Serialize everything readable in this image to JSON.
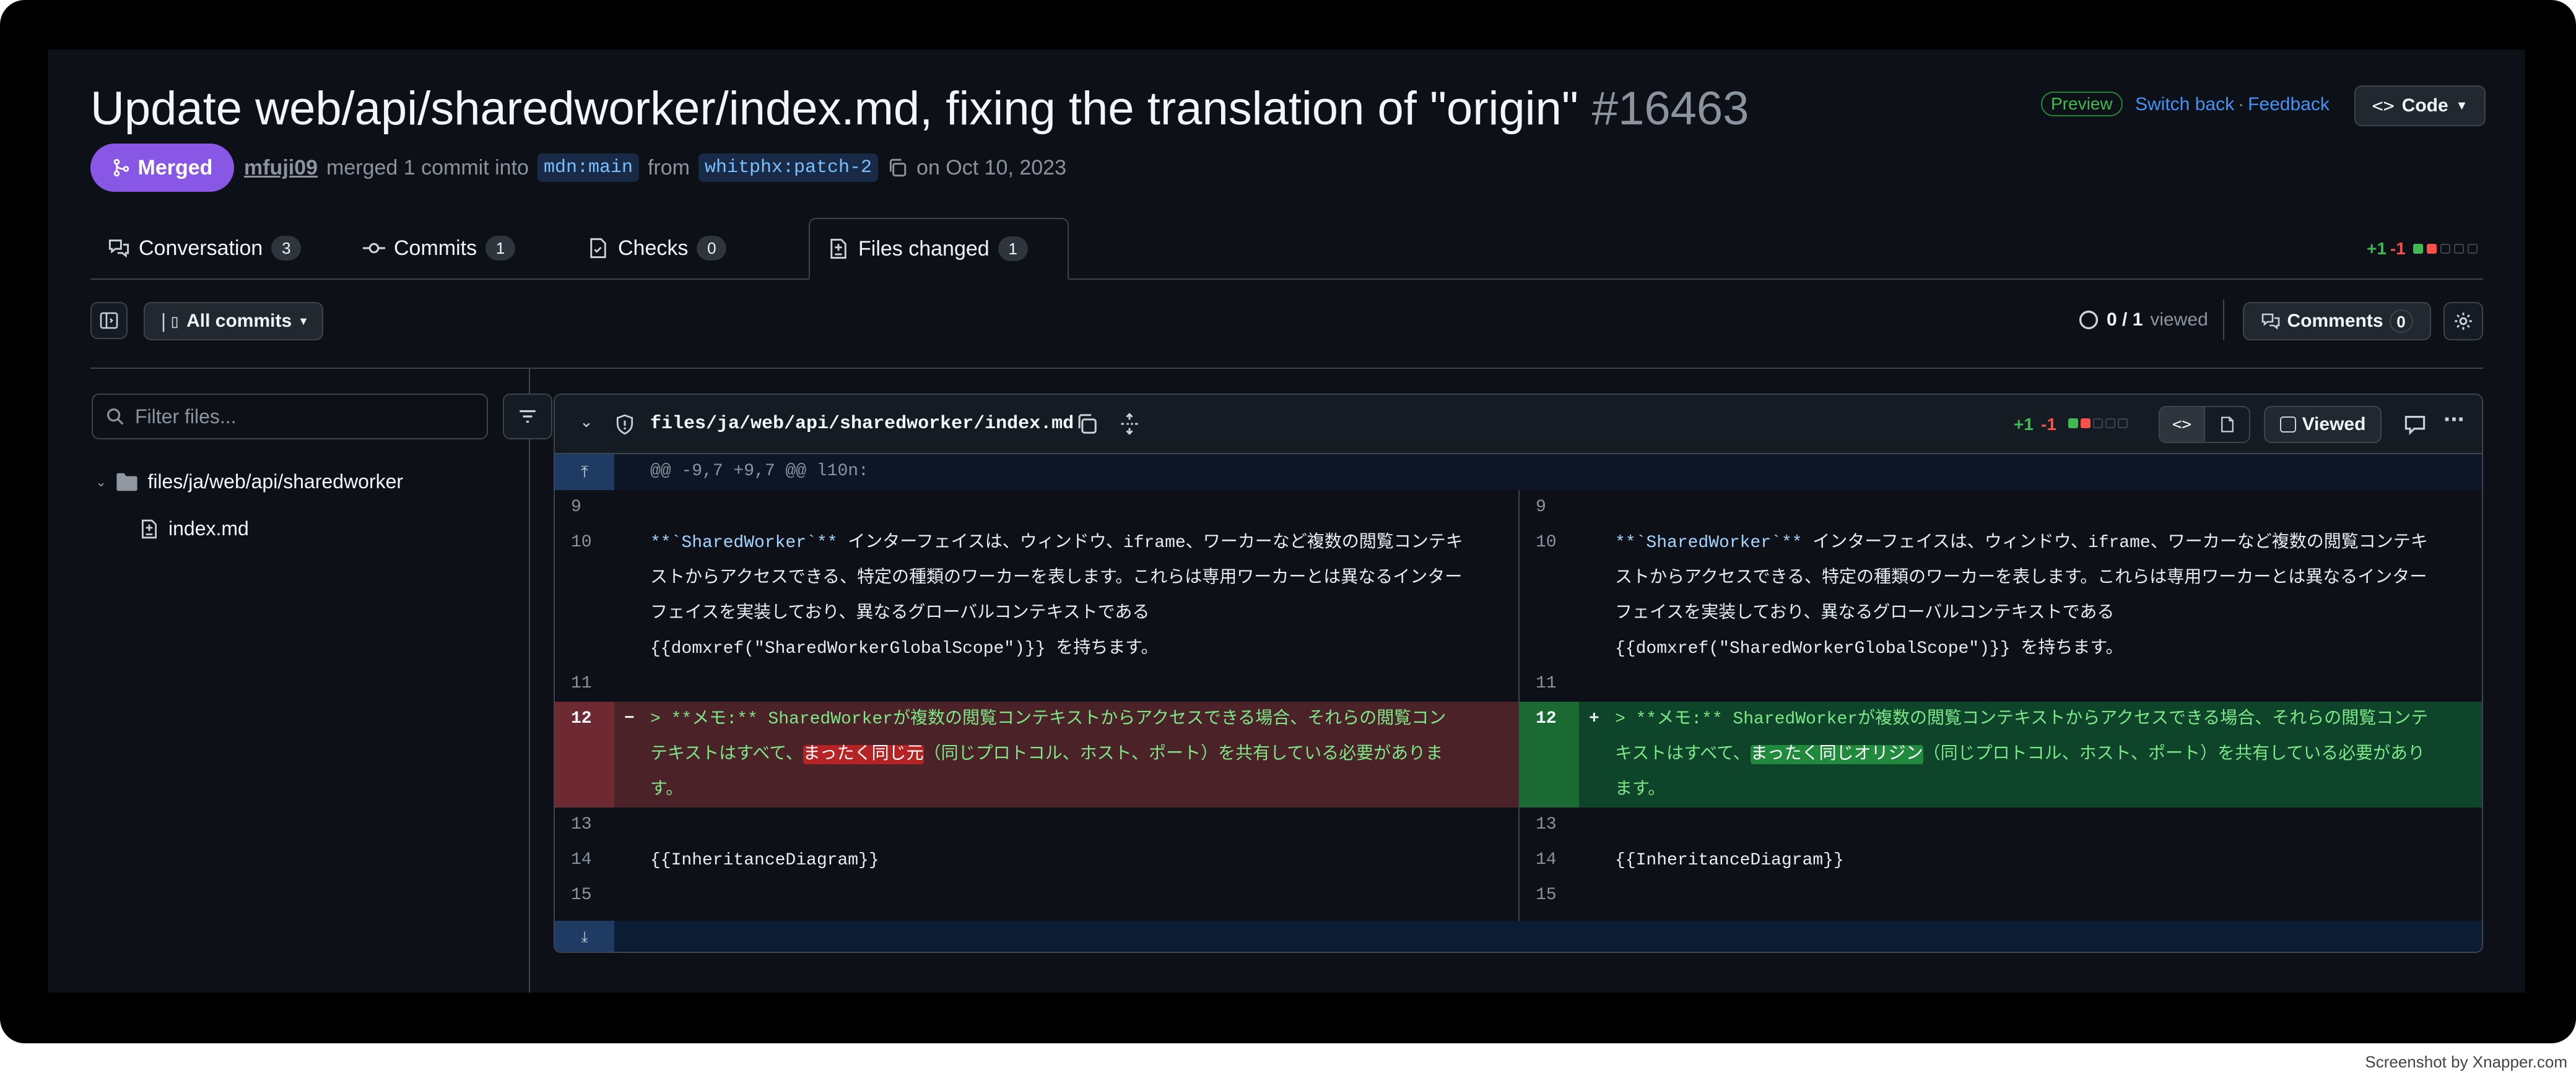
{
  "pr": {
    "title": "Update web/api/sharedworker/index.md, fixing the translation of \"origin\"",
    "number": "#16463",
    "state": "Merged",
    "author": "mfuji09",
    "merged_text": "merged 1 commit into",
    "base_branch": "mdn:main",
    "from_text": "from",
    "head_branch": "whitphx:patch-2",
    "date_text": "on Oct 10, 2023"
  },
  "header_right": {
    "preview_label": "Preview",
    "switch_back": "Switch back",
    "separator": "·",
    "feedback": "Feedback",
    "code_button": "Code"
  },
  "tabs": [
    {
      "label": "Conversation",
      "count": "3",
      "icon": "comment-discussion-icon"
    },
    {
      "label": "Commits",
      "count": "1",
      "icon": "git-commit-icon"
    },
    {
      "label": "Checks",
      "count": "0",
      "icon": "checklist-icon"
    },
    {
      "label": "Files changed",
      "count": "1",
      "icon": "file-diff-icon",
      "active": true
    }
  ],
  "diffstat": {
    "additions": "+1",
    "deletions": "-1"
  },
  "toolbar": {
    "all_commits": "All commits",
    "viewed_count": "0 / 1",
    "viewed_label": "viewed",
    "comments_label": "Comments",
    "comments_count": "0"
  },
  "sidebar": {
    "filter_placeholder": "Filter files...",
    "folder": "files/ja/web/api/sharedworker",
    "file": "index.md"
  },
  "file": {
    "path": "files/ja/web/api/sharedworker/index.md",
    "additions": "+1",
    "deletions": "-1",
    "viewed_button": "Viewed",
    "hunk_header": "@@ -9,7 +9,7 @@ l10n:"
  },
  "diff": {
    "lines": {
      "l9": "9",
      "l10": "10",
      "l11": "11",
      "l12": "12",
      "l13": "13",
      "l14": "14",
      "l15": "15"
    },
    "line10_bold": "**`SharedWorker`**",
    "line10_a": " インターフェイスは、ウィンドウ、iframe、ワーカーなど複数の閲覧コンテキ",
    "line10_b": "ストからアクセスできる、特定の種類のワーカーを表します。これらは専用ワーカーとは異なるインター",
    "line10_c": "フェイスを実装しており、異なるグローバルコンテキストである",
    "line10_d": "{{domxref(\"SharedWorkerGlobalScope\")}} を持ちます。",
    "line14": "{{InheritanceDiagram}}",
    "del_sign": "−",
    "add_sign": "+",
    "del_a": "> **メモ:** SharedWorkerが複数の閲覧コンテキストからアクセスできる場合、それらの閲覧コン",
    "del_b1": "テキストはすべて、",
    "del_word": "まったく同じ元",
    "del_b2": "（同じプロトコル、ホスト、ポート）を共有している必要がありま",
    "del_c": "す。",
    "add_a": "> **メモ:** SharedWorkerが複数の閲覧コンテキストからアクセスできる場合、それらの閲覧コンテ",
    "add_b1": "キストはすべて、",
    "add_word": "まったく同じオリジン",
    "add_b2": "（同じプロトコル、ホスト、ポート）を共有している必要があり",
    "add_c": "ます。"
  },
  "watermark": "Screenshot by Xnapper.com",
  "colors": {
    "merged": "#8957e5",
    "addition": "#3fb950",
    "deletion": "#f85149",
    "link": "#4493f8"
  }
}
